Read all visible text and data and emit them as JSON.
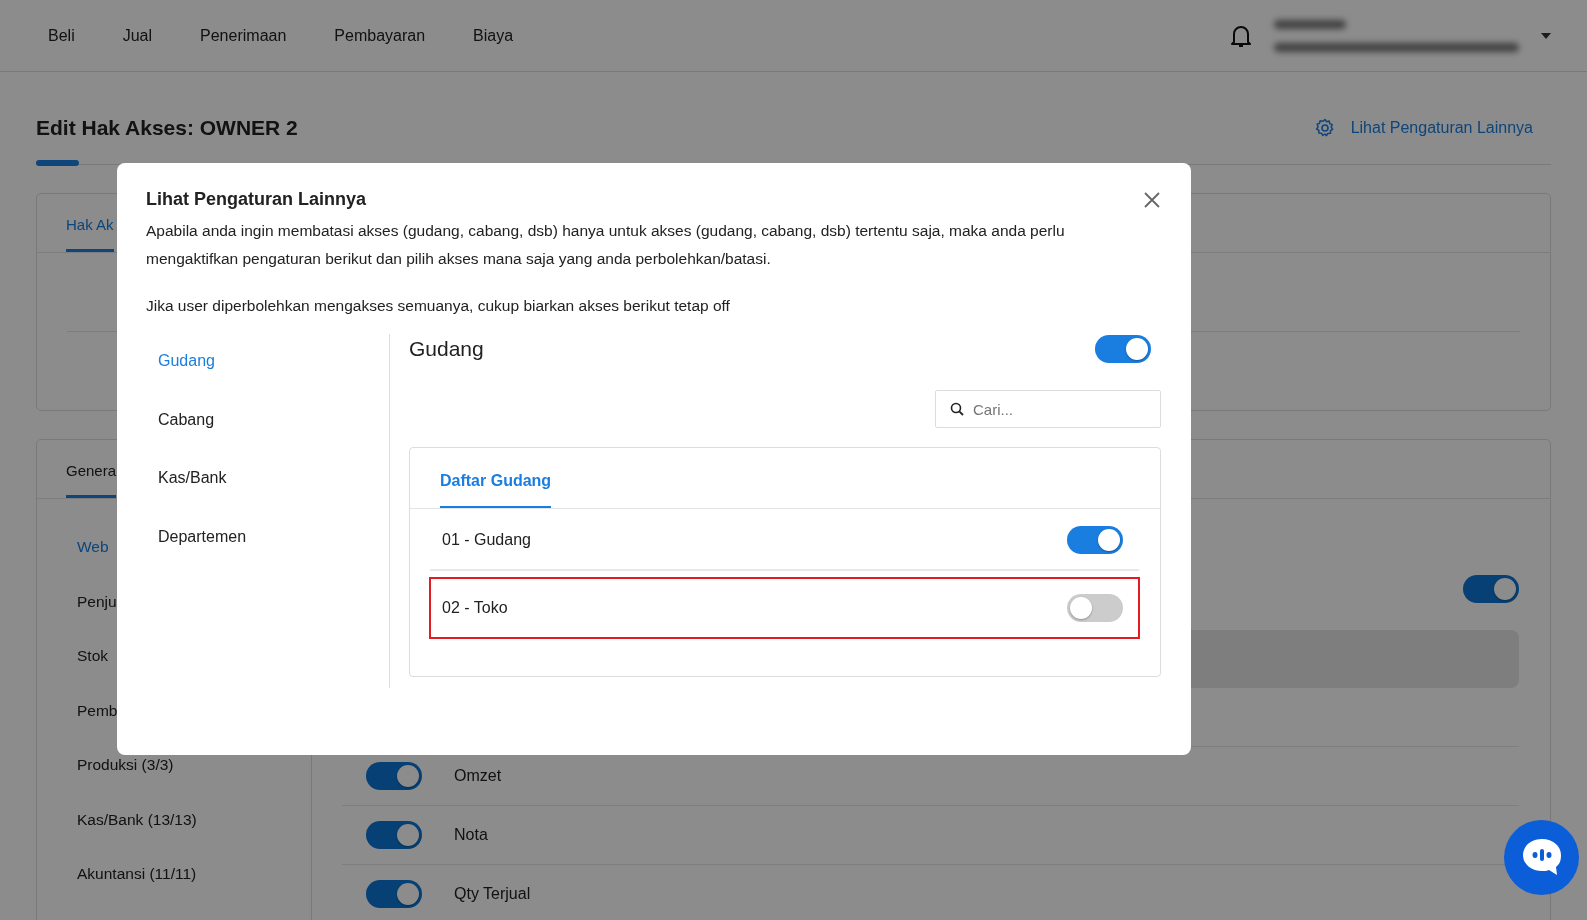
{
  "nav": {
    "items": [
      "Beli",
      "Jual",
      "Penerimaan",
      "Pembayaran",
      "Biaya"
    ]
  },
  "page": {
    "title": "Edit Hak Akses: OWNER 2",
    "settings_link": "Lihat Pengaturan Lainnya"
  },
  "top_card": {
    "tab": "Hak Ak"
  },
  "main_card": {
    "tab": "Genera",
    "sidebar": [
      {
        "label": "Web",
        "selected": true
      },
      {
        "label": "Penju",
        "selected": false
      },
      {
        "label": "Stok",
        "selected": false
      },
      {
        "label": "Pemb",
        "selected": false
      },
      {
        "label": "Produksi (3/3)",
        "selected": false
      },
      {
        "label": "Kas/Bank (13/13)",
        "selected": false
      },
      {
        "label": "Akuntansi (11/11)",
        "selected": false
      }
    ],
    "header_toggle": {
      "on": true
    },
    "rows": [
      {
        "label": "Omzet",
        "on": true
      },
      {
        "label": "Nota",
        "on": true
      },
      {
        "label": "Qty Terjual",
        "on": true
      }
    ]
  },
  "modal": {
    "title": "Lihat Pengaturan Lainnya",
    "paragraphs": [
      "Apabila anda ingin membatasi akses (gudang, cabang, dsb) hanya untuk akses (gudang, cabang, dsb) tertentu saja, maka anda perlu mengaktifkan pengaturan berikut dan pilih akses mana saja yang anda perbolehkan/batasi.",
      "Jika user diperbolehkan mengakses semuanya, cukup biarkan akses berikut tetap off"
    ],
    "menu": [
      {
        "label": "Gudang",
        "selected": true
      },
      {
        "label": "Cabang",
        "selected": false
      },
      {
        "label": "Kas/Bank",
        "selected": false
      },
      {
        "label": "Departemen",
        "selected": false
      }
    ],
    "section": {
      "title": "Gudang",
      "on": true,
      "search": {
        "placeholder": "Cari..."
      },
      "tabs": [
        {
          "label": "Daftar Gudang",
          "selected": true
        }
      ],
      "items": [
        {
          "label": "01 - Gudang",
          "on": true,
          "highlighted": false
        },
        {
          "label": "02 - Toko",
          "on": false,
          "highlighted": true
        }
      ]
    }
  }
}
